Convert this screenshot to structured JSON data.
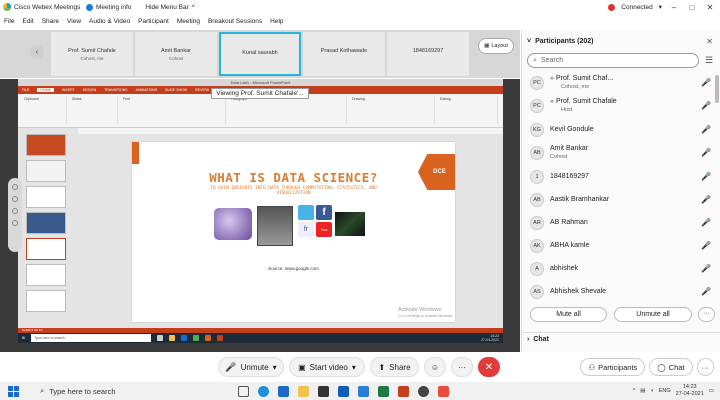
{
  "titlebar": {
    "app_name": "Cisco Webex Meetings",
    "meeting_info": "Meeting info",
    "hide_menu": "Hide Menu Bar",
    "hide_menu_chevron": "^",
    "connection": "Connected",
    "connection_chevron": "▾"
  },
  "menu": [
    "File",
    "Edit",
    "Share",
    "View",
    "Audio & Video",
    "Participant",
    "Meeting",
    "Breakout Sessions",
    "Help"
  ],
  "video_tiles": [
    {
      "name": "Prof. Sumit Chafale",
      "role": "Cohost, me"
    },
    {
      "name": "Amit Bankar",
      "role": "Cohost"
    },
    {
      "name": "Kunal saurabh",
      "role": ""
    },
    {
      "name": "Prasad Kothawade",
      "role": ""
    },
    {
      "name": "18481692​97",
      "role": ""
    }
  ],
  "strip_prev": "‹",
  "strip_next": "›",
  "layout_label": "Layout",
  "viewing_banner": "Viewing Prof. Sumit Chafale'...",
  "ppt": {
    "window_title": "Data Lab1 - Microsoft PowerPoint",
    "tabs": [
      "FILE",
      "HOME",
      "INSERT",
      "DESIGN",
      "TRANSITIONS",
      "ANIMATIONS",
      "SLIDE SHOW",
      "REVIEW",
      "VIEW"
    ],
    "ribbon_groups": [
      "Clipboard",
      "Slides",
      "Font",
      "Paragraph",
      "Drawing",
      "Editing"
    ],
    "slide_title": "WHAT IS DATA SCIENCE?",
    "slide_subtitle": "TO GAIN INSIGHTS INTO DATA THROUGH COMPUTATION, STATISTICS, AND VISUALIZATION",
    "slide_source": "Source: www.google.com",
    "logo_text": "DCE",
    "status_text": "SLIDE 6 OF 10",
    "activate_line1": "Activate Windows",
    "activate_line2": "Go to Settings to activate Windows.",
    "inner_search": "Type here to search",
    "inner_time": "14:23",
    "inner_date": "27-04-2021"
  },
  "controls": {
    "unmute": "Unmute",
    "start_video": "Start video",
    "share": "Share",
    "mute_icon": "🎤",
    "video_icon": "▣",
    "share_icon": "⬆",
    "emoji_icon": "☺",
    "more_icon": "···",
    "end_icon": "✕",
    "chevron": "▾"
  },
  "panel": {
    "title": "Participants (202)",
    "collapse_icon": "˅",
    "close_icon": "✕",
    "search_placeholder": "Search",
    "list_icon": "☰",
    "participants": [
      {
        "initials": "PC",
        "name": "Prof. Sumit Chaf...",
        "role": "Cohost, me",
        "icon": "⟡"
      },
      {
        "initials": "PC",
        "name": "Prof. Sumit Chafale",
        "role": "Host",
        "icon": "⟡"
      },
      {
        "initials": "KG",
        "name": "Kevil Gondule",
        "role": "",
        "icon": ""
      },
      {
        "initials": "AB",
        "name": "Amit Bankar",
        "role": "Cohost",
        "icon": ""
      },
      {
        "initials": "1",
        "name": "18481692​97",
        "role": "",
        "icon": ""
      },
      {
        "initials": "AB",
        "name": "Aastik Bramhankar",
        "role": "",
        "icon": ""
      },
      {
        "initials": "AR",
        "name": "AB Rahman",
        "role": "",
        "icon": ""
      },
      {
        "initials": "AK",
        "name": "ABHA kamle",
        "role": "",
        "icon": ""
      },
      {
        "initials": "A",
        "name": "abhishek",
        "role": "",
        "icon": ""
      },
      {
        "initials": "AS",
        "name": "Abhishek Shevale",
        "role": "",
        "icon": ""
      }
    ],
    "mic_icon": "🎤",
    "mute_all": "Mute all",
    "unmute_all": "Unmute all",
    "more": "···",
    "chat_chevron": "›",
    "chat_title": "Chat"
  },
  "panel_tabs": {
    "participants": "Participants",
    "chat": "Chat",
    "people_icon": "⚇",
    "chat_icon": "◯",
    "more": "···"
  },
  "taskbar": {
    "search_placeholder": "Type here to search",
    "search_icon": "⌕",
    "lang": "ENG",
    "time": "14:23",
    "date": "27-04-2021"
  },
  "colors": {
    "accent": "#27b5d8",
    "end_red": "#e23b3b",
    "mic_red": "#d93025",
    "ppt_red": "#c43e1c",
    "slide_orange": "#e07b2d"
  }
}
